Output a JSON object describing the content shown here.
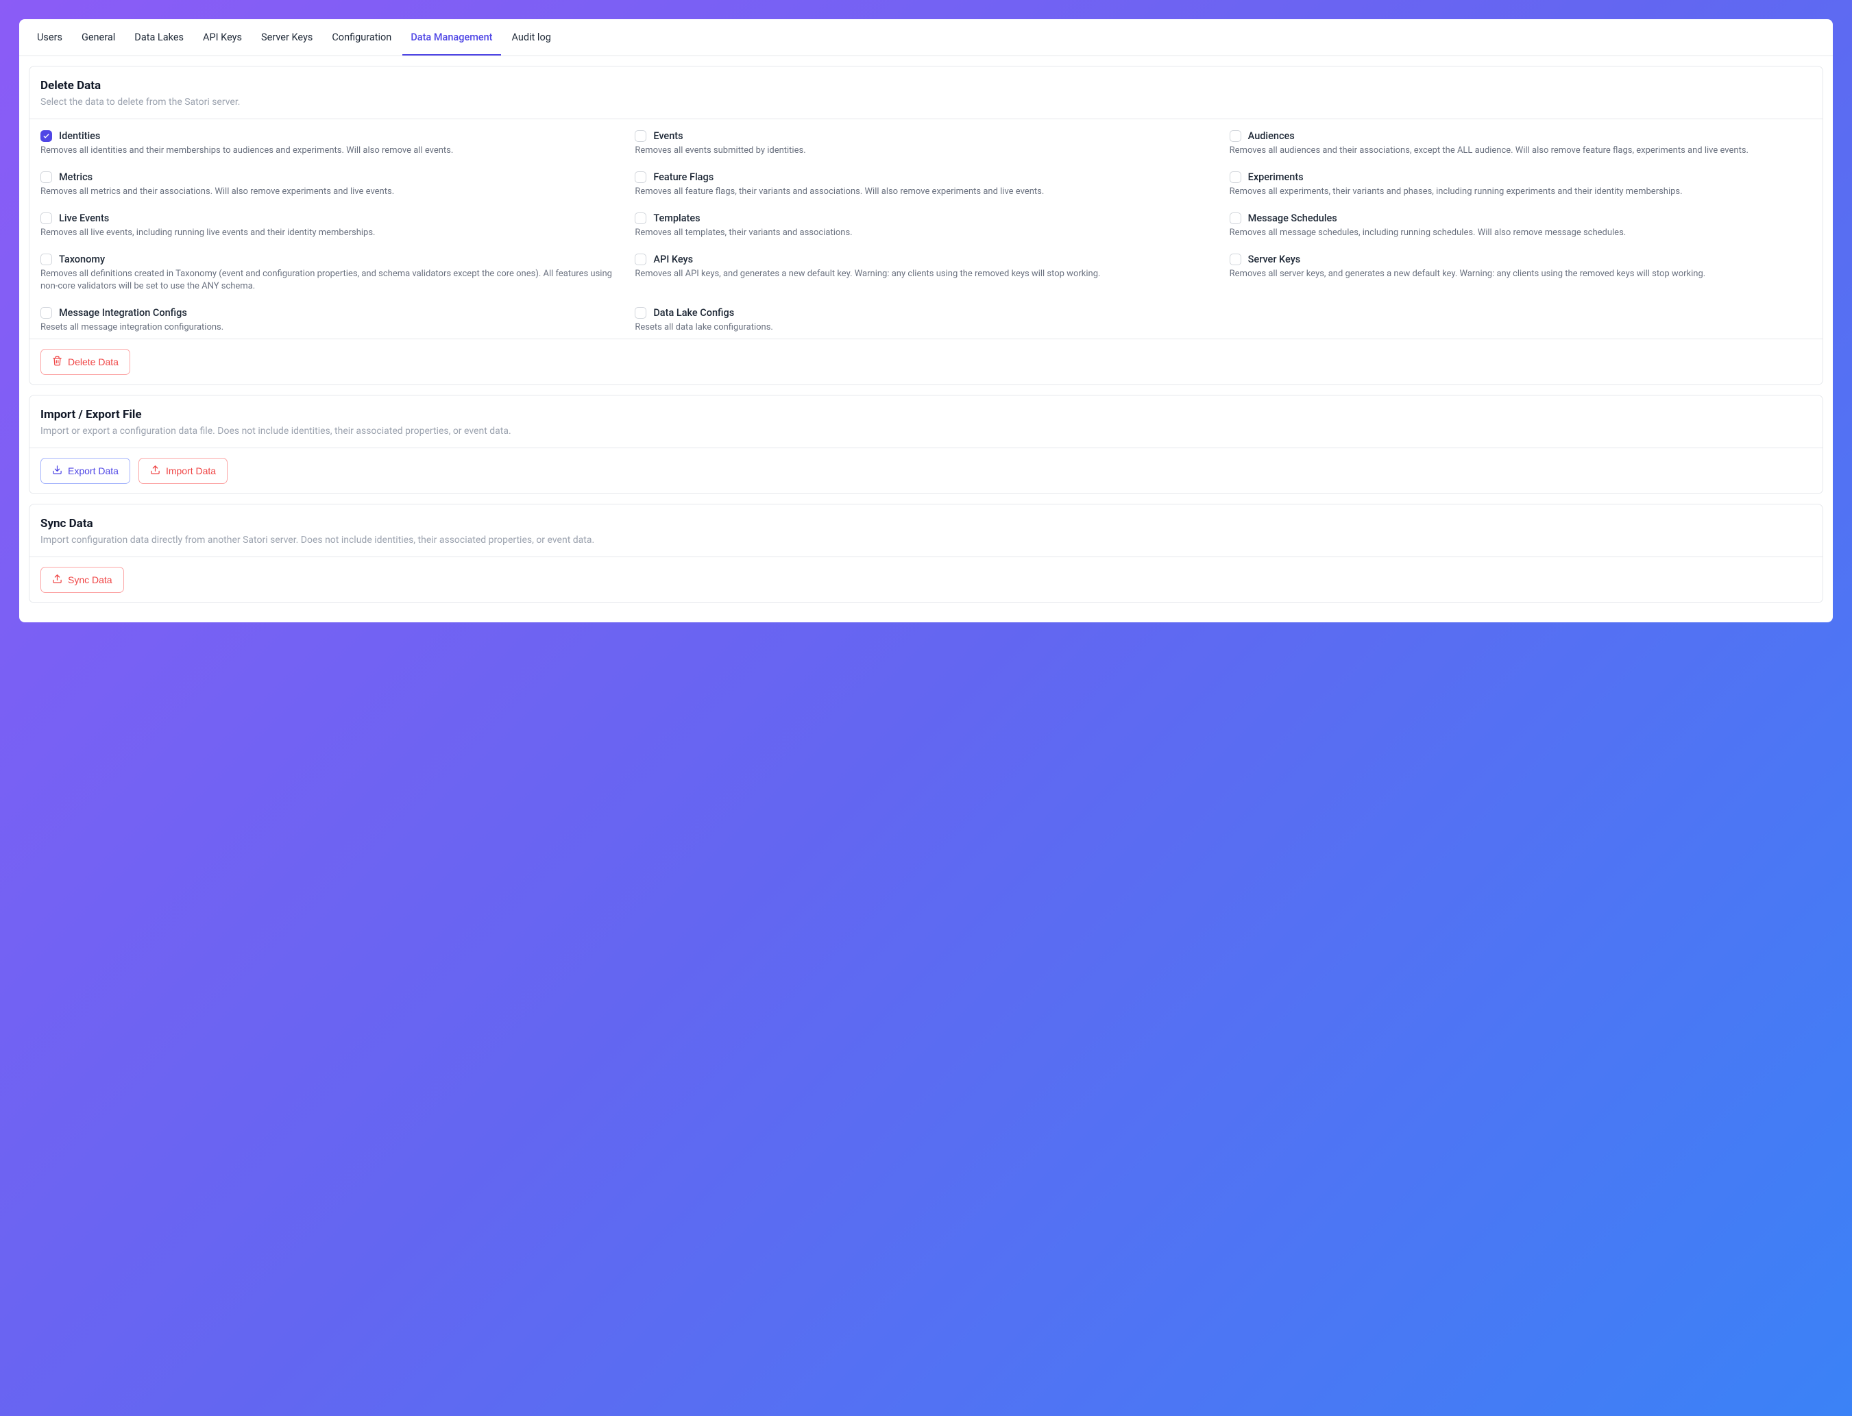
{
  "tabs": {
    "items": [
      {
        "label": "Users",
        "active": false
      },
      {
        "label": "General",
        "active": false
      },
      {
        "label": "Data Lakes",
        "active": false
      },
      {
        "label": "API Keys",
        "active": false
      },
      {
        "label": "Server Keys",
        "active": false
      },
      {
        "label": "Configuration",
        "active": false
      },
      {
        "label": "Data Management",
        "active": true
      },
      {
        "label": "Audit log",
        "active": false
      }
    ]
  },
  "delete_section": {
    "title": "Delete Data",
    "subtitle": "Select the data to delete from the Satori server.",
    "items": [
      {
        "label": "Identities",
        "desc": "Removes all identities and their memberships to audiences and experiments. Will also remove all events.",
        "checked": true
      },
      {
        "label": "Events",
        "desc": "Removes all events submitted by identities.",
        "checked": false
      },
      {
        "label": "Audiences",
        "desc": "Removes all audiences and their associations, except the ALL audience. Will also remove feature flags, experiments and live events.",
        "checked": false
      },
      {
        "label": "Metrics",
        "desc": "Removes all metrics and their associations. Will also remove experiments and live events.",
        "checked": false
      },
      {
        "label": "Feature Flags",
        "desc": "Removes all feature flags, their variants and associations. Will also remove experiments and live events.",
        "checked": false
      },
      {
        "label": "Experiments",
        "desc": "Removes all experiments, their variants and phases, including running experiments and their identity memberships.",
        "checked": false
      },
      {
        "label": "Live Events",
        "desc": "Removes all live events, including running live events and their identity memberships.",
        "checked": false
      },
      {
        "label": "Templates",
        "desc": "Removes all templates, their variants and associations.",
        "checked": false
      },
      {
        "label": "Message Schedules",
        "desc": "Removes all message schedules, including running schedules. Will also remove message schedules.",
        "checked": false
      },
      {
        "label": "Taxonomy",
        "desc": "Removes all definitions created in Taxonomy (event and configuration properties, and schema validators except the core ones). All features using non-core validators will be set to use the ANY schema.",
        "checked": false
      },
      {
        "label": "API Keys",
        "desc": "Removes all API keys, and generates a new default key. Warning: any clients using the removed keys will stop working.",
        "checked": false
      },
      {
        "label": "Server Keys",
        "desc": "Removes all server keys, and generates a new default key. Warning: any clients using the removed keys will stop working.",
        "checked": false
      },
      {
        "label": "Message Integration Configs",
        "desc": "Resets all message integration configurations.",
        "checked": false
      },
      {
        "label": "Data Lake Configs",
        "desc": "Resets all data lake configurations.",
        "checked": false
      }
    ],
    "button": "Delete Data"
  },
  "import_export_section": {
    "title": "Import / Export File",
    "subtitle": "Import or export a configuration data file. Does not include identities, their associated properties, or event data.",
    "export_button": "Export Data",
    "import_button": "Import Data"
  },
  "sync_section": {
    "title": "Sync Data",
    "subtitle": "Import configuration data directly from another Satori server. Does not include identities, their associated properties, or event data.",
    "button": "Sync Data"
  }
}
